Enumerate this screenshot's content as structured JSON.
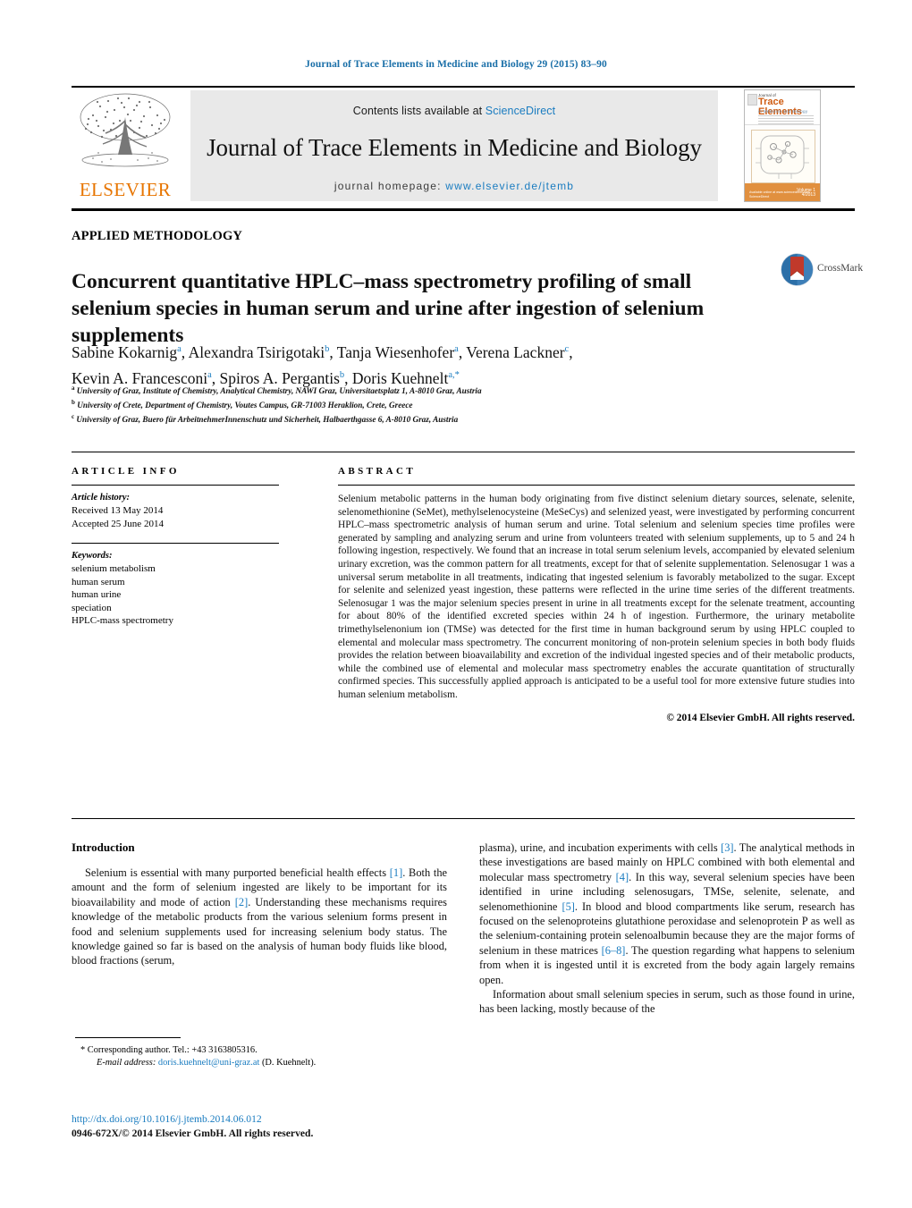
{
  "running_head": "Journal of Trace Elements in Medicine and Biology 29 (2015) 83–90",
  "masthead": {
    "contents_prefix": "Contents lists available at ",
    "sciencedirect": "ScienceDirect",
    "journal_title": "Journal of Trace Elements in Medicine and Biology",
    "homepage_label": "journal homepage:",
    "homepage_url": "www.elsevier.de/jtemb",
    "publisher": "ELSEVIER",
    "cover": {
      "brand": "Journal of",
      "title": "Trace Elements",
      "subtitle": "in Medicine and Biology",
      "volume": "Volume 1",
      "issue": "4/2013",
      "footer_left": "Available online at\nwww.sciencedirect.com\nScienceDirect"
    },
    "colors": {
      "banner_bg": "#e9e9e9",
      "link": "#1a7cc0",
      "elsevier_orange": "#E77500",
      "cover_orange": "#e1903f"
    }
  },
  "article": {
    "section_type": "APPLIED METHODOLOGY",
    "title": "Concurrent quantitative HPLC–mass spectrometry profiling of small selenium species in human serum and urine after ingestion of selenium supplements",
    "crossmark_label": "CrossMark",
    "authors": [
      {
        "name": "Sabine Kokarnig",
        "marks": "a",
        "sep": ", "
      },
      {
        "name": "Alexandra Tsirigotaki",
        "marks": "b",
        "sep": ", "
      },
      {
        "name": "Tanja Wiesenhofer",
        "marks": "a",
        "sep": ", "
      },
      {
        "name": "Verena Lackner",
        "marks": "c",
        "sep": ","
      },
      {
        "name": "Kevin A. Francesconi",
        "marks": "a",
        "sep": ", "
      },
      {
        "name": "Spiros A. Pergantis",
        "marks": "b",
        "sep": ", "
      },
      {
        "name": "Doris Kuehnelt",
        "marks": "a,*",
        "sep": ""
      }
    ],
    "affiliations": [
      {
        "mark": "a",
        "text": "University of Graz, Institute of Chemistry, Analytical Chemistry, NAWI Graz, Universitaetsplatz 1, A-8010 Graz, Austria"
      },
      {
        "mark": "b",
        "text": "University of Crete, Department of Chemistry, Voutes Campus, GR-71003 Heraklion, Crete, Greece"
      },
      {
        "mark": "c",
        "text": "University of Graz, Buero für ArbeitnehmerInnenschutz und Sicherheit, Halbaerthgasse 6, A-8010 Graz, Austria"
      }
    ]
  },
  "article_info": {
    "heading": "ARTICLE INFO",
    "history_label": "Article history:",
    "history": [
      "Received 13 May 2014",
      "Accepted 25 June 2014"
    ],
    "keywords_label": "Keywords:",
    "keywords": [
      "selenium metabolism",
      "human serum",
      "human urine",
      "speciation",
      "HPLC-mass spectrometry"
    ]
  },
  "abstract": {
    "heading": "ABSTRACT",
    "text": "Selenium metabolic patterns in the human body originating from five distinct selenium dietary sources, selenate, selenite, selenomethionine (SeMet), methylselenocysteine (MeSeCys) and selenized yeast, were investigated by performing concurrent HPLC–mass spectrometric analysis of human serum and urine. Total selenium and selenium species time profiles were generated by sampling and analyzing serum and urine from volunteers treated with selenium supplements, up to 5 and 24 h following ingestion, respectively. We found that an increase in total serum selenium levels, accompanied by elevated selenium urinary excretion, was the common pattern for all treatments, except for that of selenite supplementation. Selenosugar 1 was a universal serum metabolite in all treatments, indicating that ingested selenium is favorably metabolized to the sugar. Except for selenite and selenized yeast ingestion, these patterns were reflected in the urine time series of the different treatments. Selenosugar 1 was the major selenium species present in urine in all treatments except for the selenate treatment, accounting for about 80% of the identified excreted species within 24 h of ingestion. Furthermore, the urinary metabolite trimethylselenonium ion (TMSe) was detected for the first time in human background serum by using HPLC coupled to elemental and molecular mass spectrometry. The concurrent monitoring of non-protein selenium species in both body fluids provides the relation between bioavailability and excretion of the individual ingested species and of their metabolic products, while the combined use of elemental and molecular mass spectrometry enables the accurate quantitation of structurally confirmed species. This successfully applied approach is anticipated to be a useful tool for more extensive future studies into human selenium metabolism.",
    "copyright": "© 2014 Elsevier GmbH. All rights reserved."
  },
  "introduction": {
    "heading": "Introduction",
    "left_p1_a": "Selenium is essential with many purported beneficial health effects ",
    "left_ref1": "[1]",
    "left_p1_b": ". Both the amount and the form of selenium ingested are likely to be important for its bioavailability and mode of action ",
    "left_ref2": "[2]",
    "left_p1_c": ". Understanding these mechanisms requires knowledge of the metabolic products from the various selenium forms present in food and selenium supplements used for increasing selenium body status. The knowledge gained so far is based on the analysis of human body fluids like blood, blood fractions (serum,",
    "right_p1_a": "plasma), urine, and incubation experiments with cells ",
    "right_ref3": "[3]",
    "right_p1_b": ". The analytical methods in these investigations are based mainly on HPLC combined with both elemental and molecular mass spectrometry ",
    "right_ref4": "[4]",
    "right_p1_c": ". In this way, several selenium species have been identified in urine including selenosugars, TMSe, selenite, selenate, and selenomethionine ",
    "right_ref5": "[5]",
    "right_p1_d": ". In blood and blood compartments like serum, research has focused on the selenoproteins glutathione peroxidase and selenoprotein P as well as the selenium-containing protein selenoalbumin because they are the major forms of selenium in these matrices ",
    "right_ref68": "[6–8]",
    "right_p1_e": ". The question regarding what happens to selenium from when it is ingested until it is excreted from the body again largely remains open.",
    "right_p2": "Information about small selenium species in serum, such as those found in urine, has been lacking, mostly because of the"
  },
  "footnotes": {
    "corresponding": "* Corresponding author. Tel.: +43 3163805316.",
    "email_label": "E-mail address:",
    "email": "doris.kuehnelt@uni-graz.at",
    "email_suffix": " (D. Kuehnelt).",
    "doi": "http://dx.doi.org/10.1016/j.jtemb.2014.06.012",
    "issn_line": "0946-672X/© 2014 Elsevier GmbH. All rights reserved."
  }
}
